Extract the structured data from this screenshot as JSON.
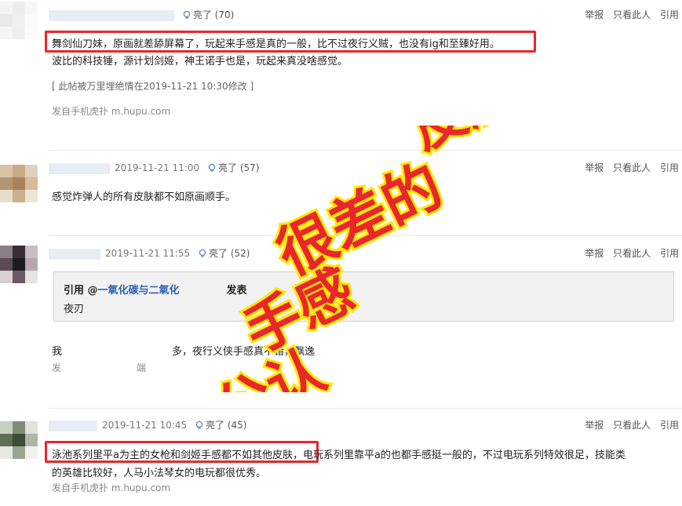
{
  "actions": {
    "report": "举报",
    "only_this": "只看此人",
    "quote": "引用"
  },
  "posts": [
    {
      "light_label": "亮了",
      "light_count": "(70)",
      "lines": [
        "舞剑仙刀妹，原画就差舔屏幕了，玩起来手感是真的一般，比不过夜行义贼，也没有ig和至臻好用。",
        "波比的科技锤，源计划剑姬，神王诺手也是，玩起来真没啥感觉。"
      ],
      "edit_note": "[ 此帖被万里埋绝情在2019-11-21 10:30修改 ]",
      "source": "发自手机虎扑 m.hupu.com"
    },
    {
      "date": "2019-11-21 11:00",
      "light_label": "亮了",
      "light_count": "(57)",
      "lines": [
        "感觉炸弹人的所有皮肤都不如原画顺手。"
      ]
    },
    {
      "date": "2019-11-21 11:55",
      "light_label": "亮了",
      "light_count": "(52)",
      "quote_prefix": "引用 @",
      "quote_user": "一氧化碳与二氧化",
      "quote_suffix": "发表",
      "quote_text": "夜刃",
      "line_start": "我",
      "line_end": "多，夜行义侠手感真不错，飘逸",
      "source_start": "发",
      "source_end": "端"
    },
    {
      "date": "2019-11-21 10:45",
      "light_label": "亮了",
      "light_count": "(45)",
      "line_a": "泳池系列里平a为主的女枪和剑姬手感都不如其他皮肤，",
      "line_b": "电玩系列里靠平a的也都手感挺一般的，不过电玩系列特效很足，技能类",
      "line_c": "的英雄比较好，人马小法琴女的电玩都很优秀。",
      "source": "发自手机虎扑 m.hupu.com"
    }
  ],
  "overlay": {
    "line1": "皮肤",
    "line2": "很差的",
    "line3": "手感",
    "line4": "玩家公认",
    "color_fill": "#e8262b",
    "color_stroke": "#ffe900"
  }
}
